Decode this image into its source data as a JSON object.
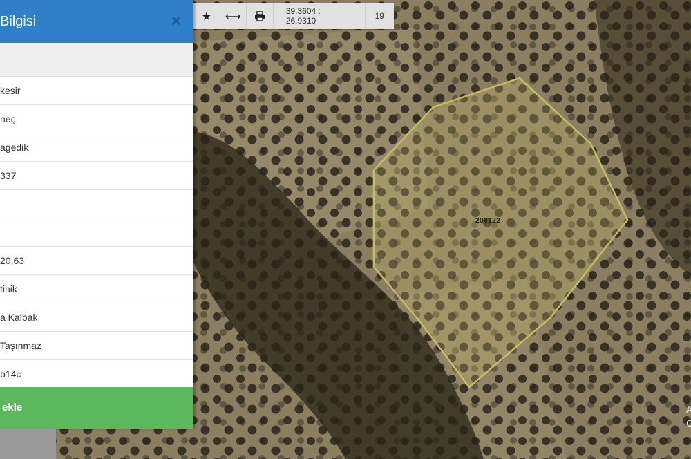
{
  "panel": {
    "title": "Bilgisi",
    "close_glyph": "×",
    "rows": [
      "kesir",
      "neç",
      "agedik",
      "337",
      "",
      "",
      "20,63",
      "tinik",
      "a Kalbak",
      "Taşınmaz",
      "b14c"
    ],
    "add_label": "ekle"
  },
  "toolbar": {
    "star_icon": "★",
    "measure_icon": "⟷",
    "print_icon": "print-icon",
    "coordinates": "39.3604 : 26.9310",
    "zoom": "19"
  },
  "map": {
    "parcel_label": "208122",
    "edge_lines": [
      "A",
      "C"
    ],
    "parcel_color": "#c6bb6a"
  }
}
